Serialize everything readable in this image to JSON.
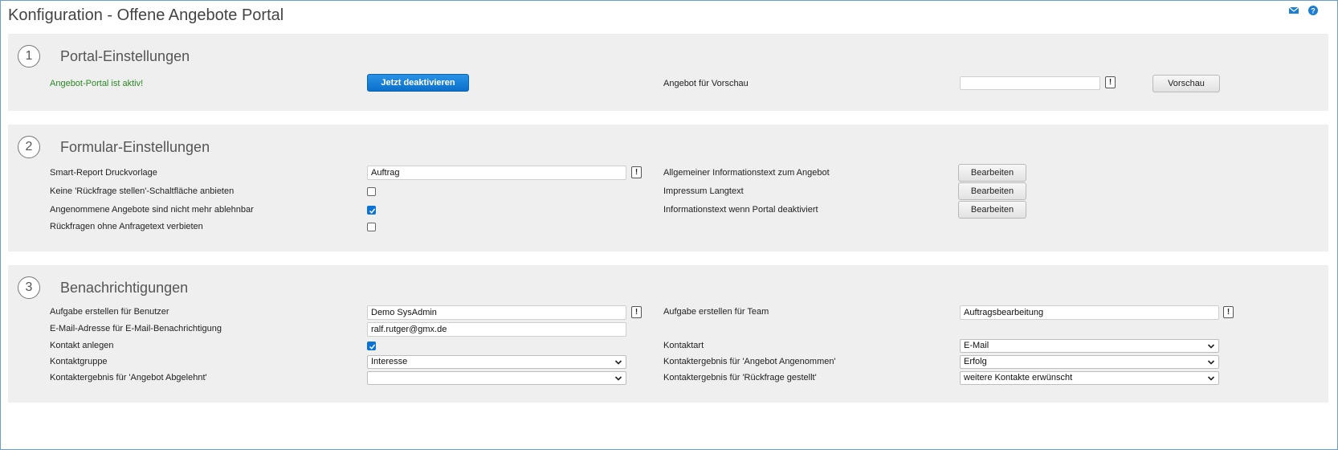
{
  "page": {
    "title": "Konfiguration - Offene Angebote Portal"
  },
  "colors": {
    "accent": "#0b73d6",
    "active_status": "#2a8a22",
    "panel_bg": "#efefef"
  },
  "icons": {
    "top": [
      "mail-icon",
      "help-icon"
    ]
  },
  "section1": {
    "number": "1",
    "title": "Portal-Einstellungen",
    "status_text": "Angebot-Portal ist aktiv!",
    "deactivate_label": "Jetzt deaktivieren",
    "preview_label": "Angebot für Vorschau",
    "preview_value": "",
    "preview_button": "Vorschau"
  },
  "section2": {
    "number": "2",
    "title": "Formular-Einstellungen",
    "report_label": "Smart-Report Druckvorlage",
    "report_value": "Auftrag",
    "no_inquiry_label": "Keine 'Rückfrage stellen'-Schaltfläche anbieten",
    "no_inquiry_checked": false,
    "accepted_label": "Angenommene Angebote sind nicht mehr ablehnbar",
    "accepted_checked": true,
    "no_empty_inquiry_label": "Rückfragen ohne Anfragetext verbieten",
    "no_empty_inquiry_checked": false,
    "info_text_label": "Allgemeiner Informationstext zum Angebot",
    "imprint_label": "Impressum Langtext",
    "disabled_text_label": "Informationstext wenn Portal deaktiviert",
    "edit_label": "Bearbeiten"
  },
  "section3": {
    "number": "3",
    "title": "Benachrichtigungen",
    "task_user_label": "Aufgabe erstellen für Benutzer",
    "task_user_value": "Demo SysAdmin",
    "email_label": "E-Mail-Adresse für E-Mail-Benachrichtigung",
    "email_value": "ralf.rutger@gmx.de",
    "contact_create_label": "Kontakt anlegen",
    "contact_create_checked": true,
    "contact_group_label": "Kontaktgruppe",
    "contact_group_value": "Interesse",
    "result_rejected_label": "Kontaktergebnis für 'Angebot Abgelehnt'",
    "result_rejected_value": "",
    "task_team_label": "Aufgabe erstellen für Team",
    "task_team_value": "Auftragsbearbeitung",
    "contact_type_label": "Kontaktart",
    "contact_type_value": "E-Mail",
    "result_accepted_label": "Kontaktergebnis für 'Angebot Angenommen'",
    "result_accepted_value": "Erfolg",
    "result_inquiry_label": "Kontaktergebnis für 'Rückfrage gestellt'",
    "result_inquiry_value": "weitere Kontakte erwünscht"
  }
}
